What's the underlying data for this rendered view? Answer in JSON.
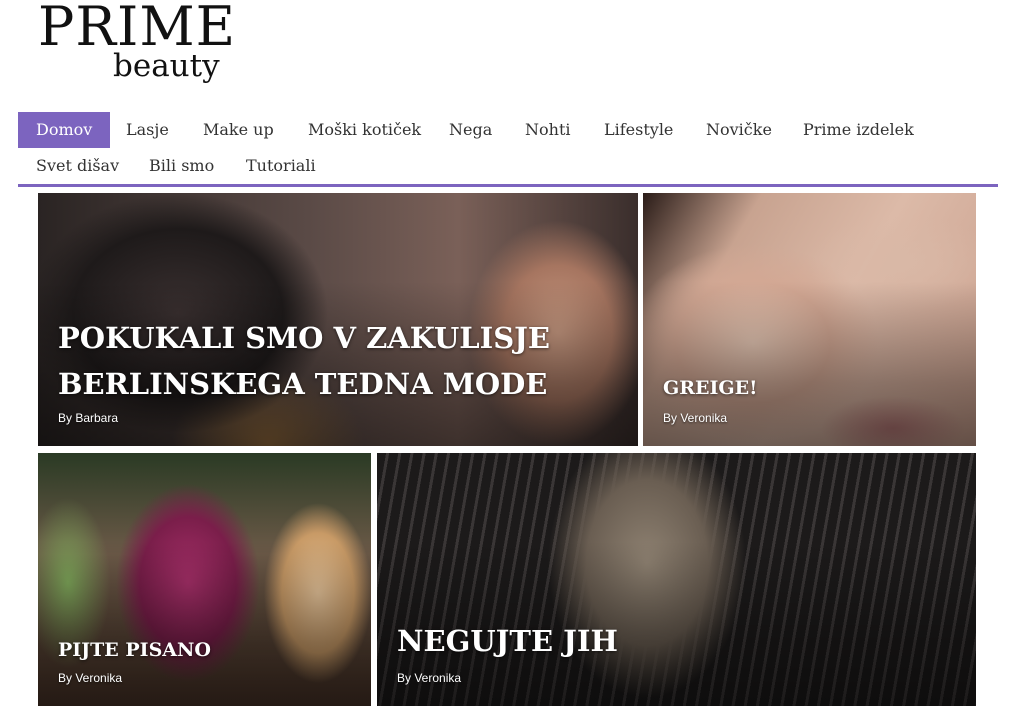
{
  "logo": {
    "prime": "PRIME",
    "beauty": "beauty"
  },
  "nav": {
    "items": [
      {
        "label": "Domov"
      },
      {
        "label": "Lasje"
      },
      {
        "label": "Make up"
      },
      {
        "label": "Moški kotiček"
      },
      {
        "label": "Nega"
      },
      {
        "label": "Nohti"
      },
      {
        "label": "Lifestyle"
      },
      {
        "label": "Novičke"
      },
      {
        "label": "Prime izdelek"
      },
      {
        "label": "Svet dišav"
      },
      {
        "label": "Bili smo"
      },
      {
        "label": "Tutoriali"
      }
    ],
    "accent_color": "#7c64bf"
  },
  "articles": [
    {
      "title_line1": "POKUKALI SMO V ZAKULISJE",
      "title_line2": "BERLINSKEGA TEDNA MODE",
      "author": "By Barbara"
    },
    {
      "title": "GREIGE!",
      "author": "By Veronika"
    },
    {
      "title": "PIJTE PISANO",
      "author": "By Veronika"
    },
    {
      "title": "NEGUJTE JIH",
      "author": "By Veronika"
    }
  ]
}
